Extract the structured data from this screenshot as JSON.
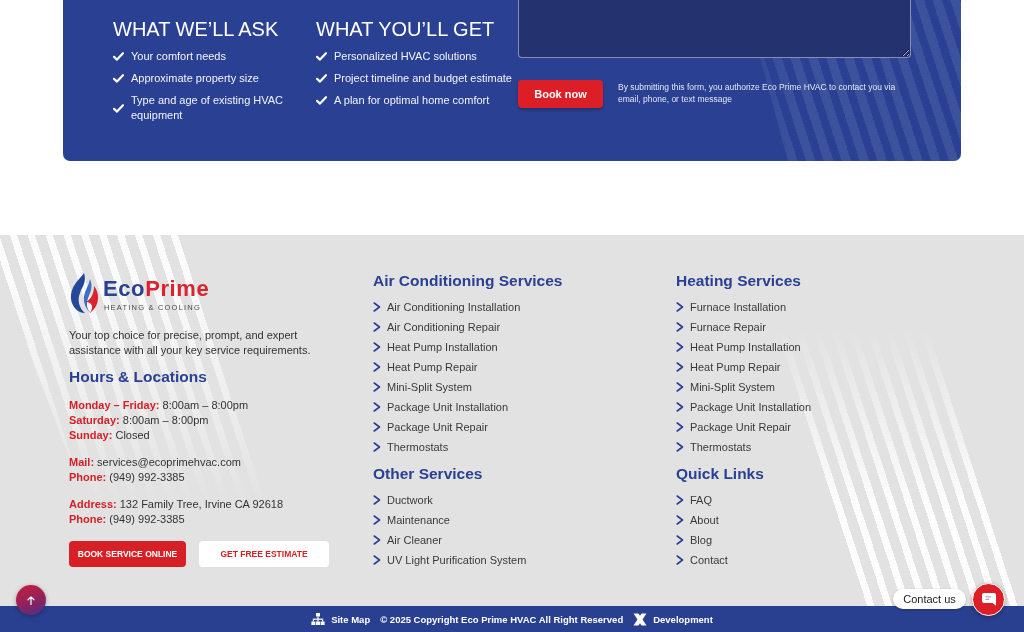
{
  "consultation": {
    "columns": [
      {
        "heading": "WHAT WE’LL ASK",
        "items": [
          "Your comfort needs",
          "Approximate property size",
          "Type and age of existing HVAC equipment"
        ]
      },
      {
        "heading": "WHAT YOU’LL GET",
        "items": [
          "Personalized HVAC solutions",
          "Project timeline and budget estimate",
          "A plan for optimal home comfort"
        ]
      }
    ],
    "form": {
      "submit": "Book now",
      "disclaimer": "By submitting this form, you authorize Eco Prime HVAC to contact you via email, phone, or text message"
    }
  },
  "footer": {
    "logo": {
      "name_parts": [
        "Eco",
        "Prime"
      ],
      "tagline": "HEATING & COOLING"
    },
    "description": "Your top choice for precise, prompt, and expert assistance with all your key service requirements.",
    "hours_heading": "Hours & Locations",
    "contact_groups": [
      [
        {
          "label": "Monday – Friday:",
          "value": "8:00am – 8:00pm"
        },
        {
          "label": "Saturday:",
          "value": "8:00am – 8:00pm"
        },
        {
          "label": "Sunday:",
          "value": "Closed"
        }
      ],
      [
        {
          "label": "Mail:",
          "value": "services@ecoprimehvac.com"
        },
        {
          "label": "Phone:",
          "value": "(949) 992-3385"
        }
      ],
      [
        {
          "label": "Address:",
          "value": "132 Family Tree, Irvine CA 92618"
        },
        {
          "label": "Phone:",
          "value": "(949) 992-3385"
        }
      ]
    ],
    "buttons": [
      {
        "label": "BOOK SERVICE ONLINE",
        "kind": "primary"
      },
      {
        "label": "GET FREE ESTIMATE",
        "kind": "secondary"
      }
    ],
    "link_columns": [
      [
        {
          "heading": "Air Conditioning Services",
          "links": [
            "Air Conditioning Installation",
            "Air Conditioning Repair",
            "Heat Pump Installation",
            "Heat Pump Repair",
            "Mini-Split System",
            "Package Unit Installation",
            "Package Unit Repair",
            "Thermostats"
          ]
        },
        {
          "heading": "Other Services",
          "links": [
            "Ductwork",
            "Maintenance",
            "Air Cleaner",
            "UV Light Purification System"
          ]
        }
      ],
      [
        {
          "heading": "Heating Services",
          "links": [
            "Furnace Installation",
            "Furnace Repair",
            "Heat Pump Installation",
            "Heat Pump Repair",
            "Mini-Split System",
            "Package Unit Installation",
            "Package Unit Repair",
            "Thermostats"
          ]
        },
        {
          "heading": "Quick Links",
          "links": [
            "FAQ",
            "About",
            "Blog",
            "Contact"
          ]
        }
      ]
    ]
  },
  "bottom_bar": {
    "items": [
      {
        "kind": "sitemap",
        "label": "Site Map"
      },
      {
        "kind": "copyright",
        "label": "© 2025 Copyright Eco Prime HVAC All Right Reserved"
      },
      {
        "kind": "credit",
        "label": "Development"
      }
    ]
  },
  "chat_widget": {
    "label": "Contact us"
  }
}
